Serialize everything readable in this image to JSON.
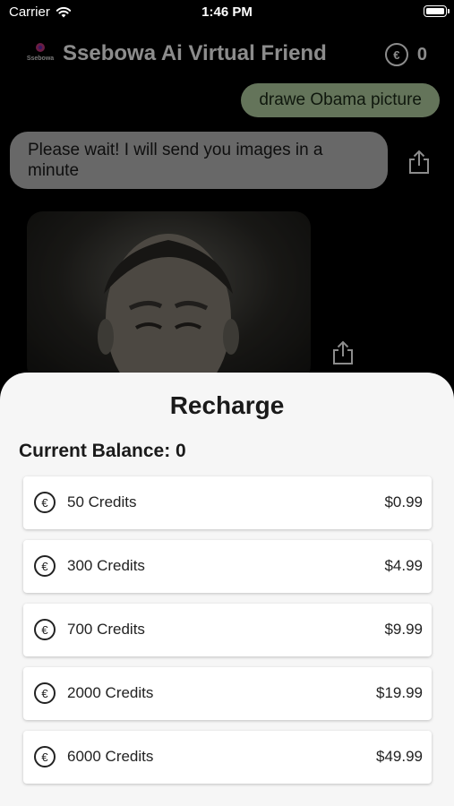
{
  "status_bar": {
    "carrier": "Carrier",
    "time": "1:46 PM"
  },
  "header": {
    "logo_text": "Ssebowa",
    "title": "Ssebowa Ai Virtual Friend",
    "currency_icon": "euro-coin-icon",
    "balance": "0"
  },
  "chat": {
    "user_message": "drawe Obama picture",
    "bot_message": "Please wait! I will send you images in a minute",
    "share_icon": "share-icon"
  },
  "recharge": {
    "title": "Recharge",
    "balance_label": "Current Balance: 0",
    "packages": [
      {
        "label": "50 Credits",
        "price": "$0.99"
      },
      {
        "label": "300 Credits",
        "price": "$4.99"
      },
      {
        "label": "700 Credits",
        "price": "$9.99"
      },
      {
        "label": "2000 Credits",
        "price": "$19.99"
      },
      {
        "label": "6000 Credits",
        "price": "$49.99"
      }
    ]
  },
  "colors": {
    "user_bubble": "#b6d3a5",
    "bot_bubble": "#bdbdbd",
    "sheet_bg": "#f6f6f6",
    "background": "#000000"
  }
}
